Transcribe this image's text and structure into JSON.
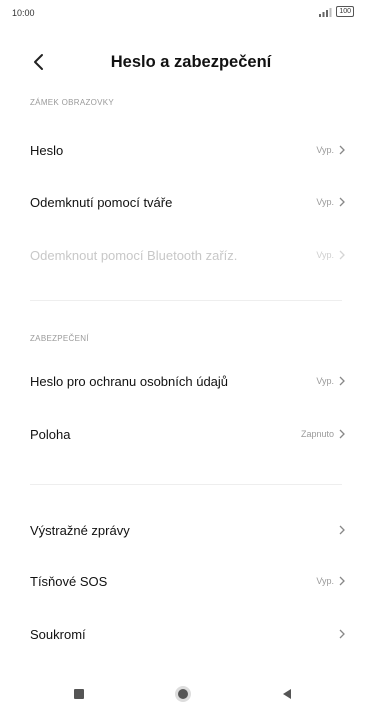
{
  "status_bar": {
    "time": "10:00",
    "signal": "↗▕▕",
    "battery": "100"
  },
  "header": {
    "title": "Heslo a zabezpečení",
    "back_icon": "chevron-left-icon"
  },
  "sections": {
    "screen_lock": {
      "label": "ZÁMEK OBRAZOVKY",
      "items": [
        {
          "label": "Heslo",
          "value": "Vyp."
        },
        {
          "label": "Odemknutí pomocí tváře",
          "value": "Vyp."
        },
        {
          "label": "Odemknout pomocí Bluetooth zaříz.",
          "value": "Vyp.",
          "disabled": true
        }
      ]
    },
    "security": {
      "label": "ZABEZPEČENÍ",
      "items": [
        {
          "label": "Heslo pro ochranu osobních údajů",
          "value": "Vyp."
        },
        {
          "label": "Poloha",
          "value": "Zapnuto"
        }
      ]
    },
    "other": {
      "items": [
        {
          "label": "Výstražné zprávy",
          "value": ""
        },
        {
          "label": "Tísňové SOS",
          "value": "Vyp."
        },
        {
          "label": "Soukromí",
          "value": ""
        }
      ]
    }
  },
  "nav_bar": {
    "icons": [
      "recent-apps-icon",
      "home-icon",
      "back-icon"
    ]
  },
  "colors": {
    "text": "#111111",
    "muted": "#9a9a9a",
    "disabled": "#c8c8c8",
    "background": "#ffffff"
  }
}
